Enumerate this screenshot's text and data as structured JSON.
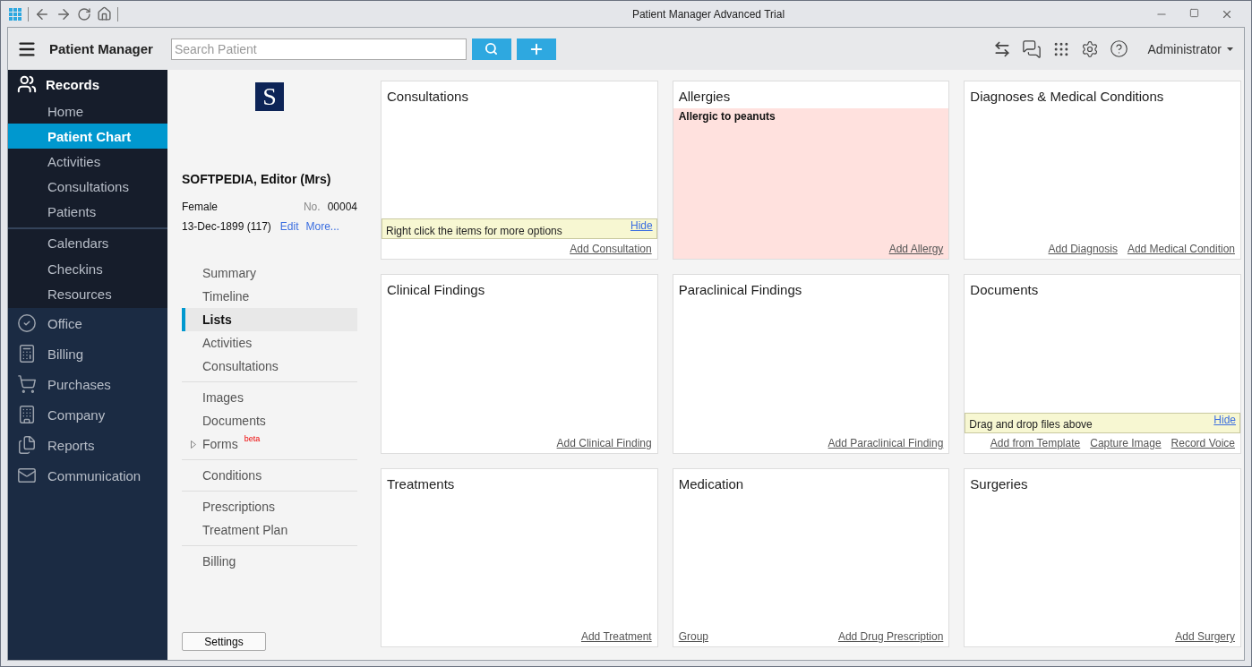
{
  "window": {
    "title": "Patient Manager Advanced Trial"
  },
  "header": {
    "app_title": "Patient Manager",
    "search": {
      "placeholder": "Search Patient"
    },
    "user": "Administrator"
  },
  "sidebar": {
    "records": {
      "label": "Records",
      "items": [
        {
          "label": "Home",
          "selected": false,
          "divider_before": false
        },
        {
          "label": "Patient Chart",
          "selected": true,
          "divider_before": false
        },
        {
          "label": "Activities",
          "selected": false,
          "divider_before": false
        },
        {
          "label": "Consultations",
          "selected": false,
          "divider_before": false
        },
        {
          "label": "Patients",
          "selected": false,
          "divider_before": false
        },
        {
          "label": "Calendars",
          "selected": false,
          "divider_before": true
        },
        {
          "label": "Checkins",
          "selected": false,
          "divider_before": false
        },
        {
          "label": "Resources",
          "selected": false,
          "divider_before": false
        }
      ]
    },
    "modules": [
      {
        "label": "Office",
        "kind": "check"
      },
      {
        "label": "Billing",
        "kind": "calculator"
      },
      {
        "label": "Purchases",
        "kind": "cart"
      },
      {
        "label": "Company",
        "kind": "building"
      },
      {
        "label": "Reports",
        "kind": "document"
      },
      {
        "label": "Communication",
        "kind": "mail"
      }
    ]
  },
  "patient": {
    "name": "SOFTPEDIA, Editor (Mrs)",
    "logo_letter": "S",
    "gender": "Female",
    "number_label": "No.",
    "number": "00004",
    "dob": "13-Dec-1899 (117)",
    "links": [
      "Edit",
      "More..."
    ],
    "menu": [
      [
        {
          "label": "Summary",
          "selected": false
        },
        {
          "label": "Timeline",
          "selected": false
        },
        {
          "label": "Lists",
          "selected": true
        },
        {
          "label": "Activities",
          "selected": false
        },
        {
          "label": "Consultations",
          "selected": false
        }
      ],
      [
        {
          "label": "Images",
          "selected": false
        },
        {
          "label": "Documents",
          "selected": false
        },
        {
          "label": "Forms",
          "selected": false,
          "expandable": true,
          "badge": "beta"
        }
      ],
      [
        {
          "label": "Conditions",
          "selected": false
        }
      ],
      [
        {
          "label": "Prescriptions",
          "selected": false
        },
        {
          "label": "Treatment Plan",
          "selected": false
        }
      ],
      [
        {
          "label": "Billing",
          "selected": false
        }
      ]
    ],
    "settings_button": "Settings"
  },
  "cards": [
    {
      "title": "Consultations",
      "alert": false,
      "note": {
        "text": "Right click the items for more options",
        "action": "Hide"
      },
      "links": [
        "Add Consultation"
      ]
    },
    {
      "title": "Allergies",
      "alert": true,
      "items": [
        "Allergic to peanuts"
      ],
      "links": [
        "Add Allergy"
      ]
    },
    {
      "title": "Diagnoses & Medical Conditions",
      "alert": false,
      "links": [
        "Add Diagnosis",
        "Add Medical Condition"
      ]
    },
    {
      "title": "Clinical Findings",
      "alert": false,
      "links": [
        "Add Clinical Finding"
      ]
    },
    {
      "title": "Paraclinical Findings",
      "alert": false,
      "links": [
        "Add Paraclinical Finding"
      ]
    },
    {
      "title": "Documents",
      "alert": false,
      "note": {
        "text": "Drag and drop files above",
        "action": "Hide"
      },
      "links": [
        "Add from Template",
        "Capture Image",
        "Record Voice"
      ]
    },
    {
      "title": "Treatments",
      "alert": false,
      "links": [
        "Add Treatment"
      ]
    },
    {
      "title": "Medication",
      "alert": false,
      "left_links": [
        "Group"
      ],
      "links": [
        "Add Drug Prescription"
      ]
    },
    {
      "title": "Surgeries",
      "alert": false,
      "links": [
        "Add Surgery"
      ]
    }
  ]
}
